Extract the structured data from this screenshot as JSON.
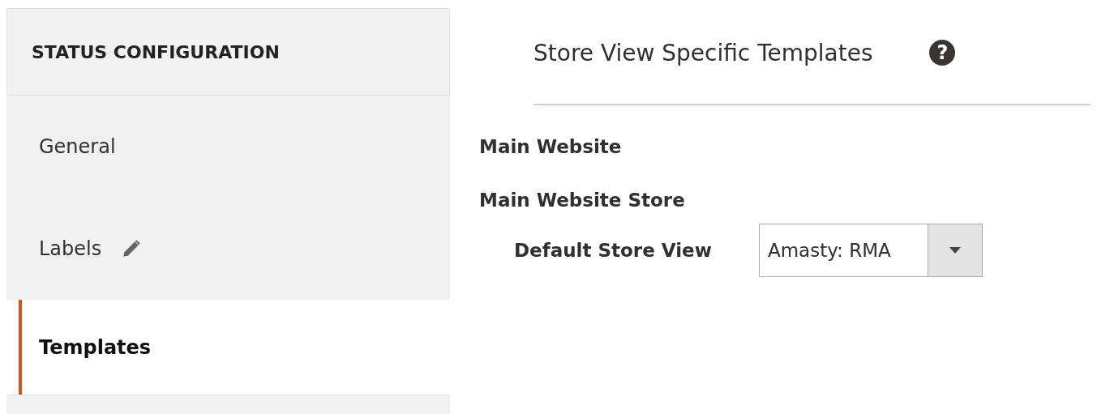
{
  "sidebar": {
    "title": "STATUS CONFIGURATION",
    "items": [
      {
        "label": "General",
        "selected": false,
        "edited": false
      },
      {
        "label": "Labels",
        "selected": false,
        "edited": true
      },
      {
        "label": "Templates",
        "selected": true,
        "edited": false
      }
    ]
  },
  "section": {
    "title": "Store View Specific Templates",
    "help": "?"
  },
  "scopes": [
    {
      "kind": "website",
      "label": "Main Website"
    },
    {
      "kind": "store",
      "label": "Main Website Store"
    },
    {
      "kind": "view",
      "label": "Default Store View",
      "value": "Amasty: RMA"
    }
  ]
}
